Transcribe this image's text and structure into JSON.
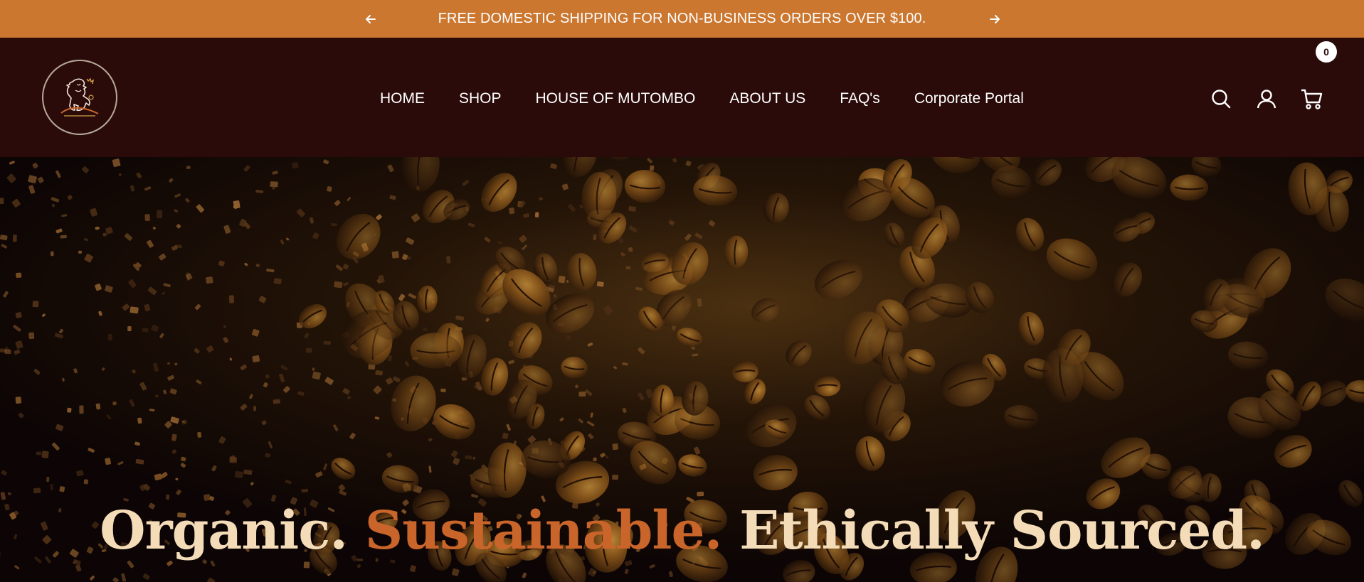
{
  "announcement": {
    "text": "FREE DOMESTIC SHIPPING FOR NON-BUSINESS ORDERS OVER $100.",
    "prev_icon": "arrow-left-icon",
    "next_icon": "arrow-right-icon"
  },
  "header": {
    "logo_icon": "lion-crest-logo",
    "nav": [
      {
        "label": "HOME"
      },
      {
        "label": "SHOP"
      },
      {
        "label": "HOUSE OF MUTOMBO"
      },
      {
        "label": "ABOUT US"
      },
      {
        "label": "FAQ's"
      },
      {
        "label": "Corporate Portal"
      }
    ],
    "icons": {
      "search": "search-icon",
      "account": "user-icon",
      "cart": "cart-icon"
    },
    "cart_count": "0"
  },
  "hero": {
    "headline_part1": "Organic.",
    "headline_part2": "Sustainable.",
    "headline_part3": "Ethically Sourced."
  },
  "colors": {
    "announcement_bg": "#cc772f",
    "header_bg": "#2a0b09",
    "headline_cream": "#f4dcb8",
    "headline_accent": "#c9652a"
  }
}
